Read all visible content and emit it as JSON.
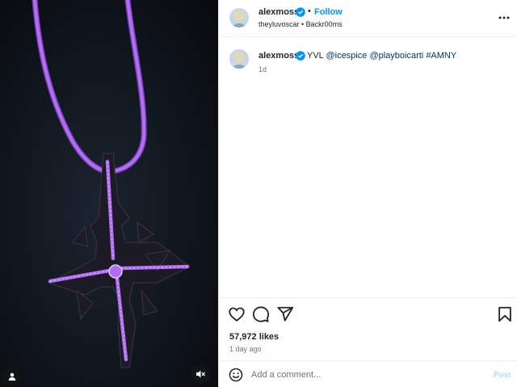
{
  "post": {
    "username": "alexmoss",
    "verified": true,
    "separator": "•",
    "follow_label": "Follow",
    "subline": "theyluvoscar • Backr00ms"
  },
  "caption": {
    "username": "alexmoss",
    "text_prefix": "YVL",
    "mentions": [
      "@icespice",
      "@playboicarti",
      "#AMNY"
    ],
    "time": "1d"
  },
  "stats": {
    "likes": "57,972 likes",
    "time": "1 day ago"
  },
  "comment": {
    "placeholder": "Add a comment...",
    "post_label": "Post"
  },
  "icons": {
    "like": "heart-icon",
    "comment": "comment-bubble-icon",
    "share": "paper-plane-icon",
    "save": "bookmark-icon",
    "emoji": "smiley-icon",
    "more": "more-options-icon",
    "verified": "verified-badge-icon",
    "user_tag": "user-tag-icon",
    "mute": "speaker-muted-icon"
  },
  "colors": {
    "accent": "#0095f6",
    "link": "#00376b",
    "gem": "#b06df0",
    "post_disabled": "#b3dbff"
  }
}
